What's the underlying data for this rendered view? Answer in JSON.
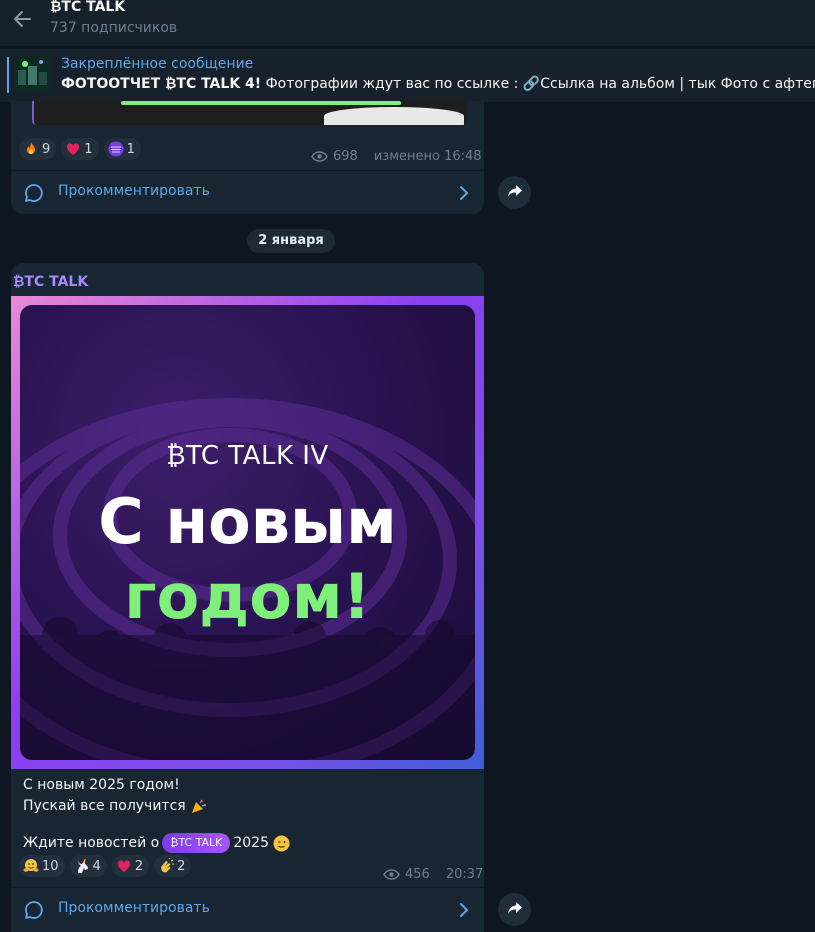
{
  "header": {
    "title": "₿TC TALK",
    "subscribers": "737 подписчиков"
  },
  "pinned": {
    "label": "Закреплённое сообщение",
    "text_bold": "ФОТООТЧЕТ ₿TC TALK 4!",
    "text_rest": " Фотографии ждут вас по ссылке : 🔗Ссылка на альбом | тык  Фото с афтепати буде"
  },
  "post1": {
    "reactions": [
      {
        "icon": "fire-icon",
        "count": "9"
      },
      {
        "icon": "heart-icon",
        "count": "1"
      },
      {
        "icon": "custom-emoji-icon",
        "count": "1"
      }
    ],
    "views": "698",
    "edited": "изменено 16:48",
    "comment_label": "Прокомментировать"
  },
  "date_separator": "2 января",
  "post2": {
    "author": "₿TC TALK",
    "image": {
      "brand": "₿TC TALK IV",
      "line1": "С новым",
      "line2": "годом!"
    },
    "text_line1": "С новым 2025 годом!",
    "text_line2": "Пускай все получится",
    "text_line3_prefix": "Ждите новостей о",
    "badge": "₿TC TALK",
    "text_line3_suffix": "2025",
    "reactions": [
      {
        "icon": "hugging-face-icon",
        "count": "10"
      },
      {
        "icon": "unicorn-icon",
        "count": "4"
      },
      {
        "icon": "heart-icon",
        "count": "2"
      },
      {
        "icon": "clapping-hands-icon",
        "count": "2"
      }
    ],
    "views": "456",
    "time": "20:37",
    "comment_label": "Прокомментировать"
  },
  "colors": {
    "background": "#0e1621",
    "bubble": "#182533",
    "accent": "#5fa7e8",
    "author": "#a78bfa",
    "green": "#7ef07a"
  }
}
